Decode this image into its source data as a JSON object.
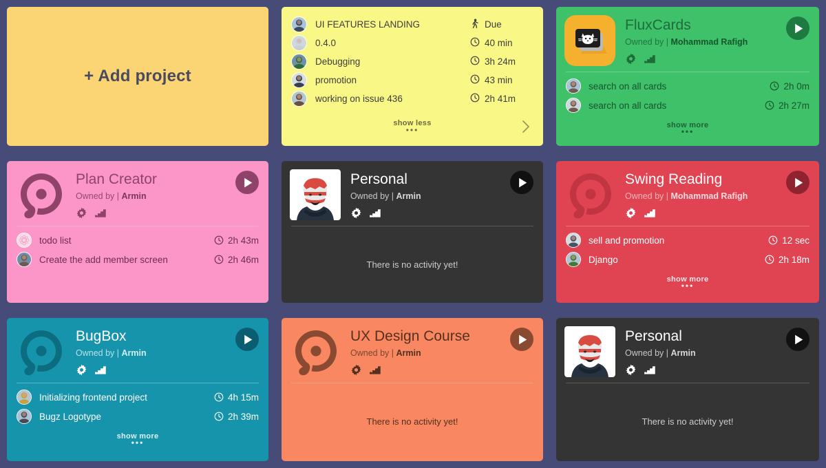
{
  "background_color": "#474b78",
  "add_project": {
    "label": "+ Add project",
    "bg": "#fbd474",
    "text_color": "#4a4a5e"
  },
  "tasks_card": {
    "bg": "#f9f786",
    "items": [
      {
        "title": "UI FEATURES LANDING",
        "meta": "Due",
        "icon": "walking-icon"
      },
      {
        "title": "0.4.0",
        "meta": "40 min",
        "icon": "clock-icon"
      },
      {
        "title": "Debugging",
        "meta": "3h 24m",
        "icon": "clock-icon"
      },
      {
        "title": "promotion",
        "meta": "43 min",
        "icon": "clock-icon"
      },
      {
        "title": "working on issue 436",
        "meta": "2h 41m",
        "icon": "clock-icon"
      }
    ],
    "show_less_label": "show less",
    "dots": "•••",
    "chevron": "chevron-right-icon"
  },
  "projects": [
    {
      "name": "FluxCards",
      "owned_by_label": "Owned by |",
      "owner": "Mohammad Rafigh",
      "bg": "#3fc16a",
      "title_color": "#1d6d3a",
      "owner_color": "#1f7440",
      "owner_name_color": "#14562c",
      "divider_color": "#6fd291",
      "play_bg": "#1d7a41",
      "play_fg": "#ffffff",
      "row_color": "#17532d",
      "logo": "fluxcards-icon",
      "logo_bg": "#f5b02e",
      "activities": [
        {
          "title": "search on all cards",
          "time": "2h 0m",
          "avatar": "#6d5b50"
        },
        {
          "title": "search on all cards",
          "time": "2h 27m",
          "avatar": "#6d5b50"
        }
      ],
      "footer": "show more",
      "footer_dots": "•••",
      "empty_text": null
    },
    {
      "name": "Plan Creator",
      "owned_by_label": "Owned by |",
      "owner": "Armin",
      "bg": "#fc96c8",
      "title_color": "#8f4369",
      "owner_color": "#94496e",
      "owner_name_color": "#7c365a",
      "divider_color": "#f2aed1",
      "play_bg": "#8f4369",
      "play_fg": "#ffffff",
      "row_color": "#6d2f50",
      "logo": "planty-logo-icon",
      "logo_bg": "#fc96c8",
      "logo_fg": "#8f4369",
      "activities": [
        {
          "title": "todo list",
          "time": "2h 43m",
          "avatar": "#fddbe9"
        },
        {
          "title": "Create the add member screen",
          "time": "2h 46m",
          "avatar": "#6d5b50"
        }
      ],
      "footer": null,
      "empty_text": null
    },
    {
      "name": "Personal",
      "owned_by_label": "Owned by |",
      "owner": "Armin",
      "bg": "#343434",
      "title_color": "#ffffff",
      "owner_color": "#c7c7c7",
      "owner_name_color": "#d8d8d8",
      "divider_color": "#595959",
      "play_bg": "#111111",
      "play_fg": "#ffffff",
      "row_color": "#cccccc",
      "logo": "photo-avatar-icon",
      "logo_bg": "#ffffff",
      "activities": [],
      "footer": null,
      "empty_text": "There is no activity yet!"
    },
    {
      "name": "Swing Reading",
      "owned_by_label": "Owned by |",
      "owner": "Mohammad Rafigh",
      "bg": "#e04453",
      "title_color": "#ffffff",
      "owner_color": "#f3b4b9",
      "owner_name_color": "#fbd9dc",
      "divider_color": "#ea767f",
      "play_bg": "#8f2430",
      "play_fg": "#ffffff",
      "row_color": "#ffffff",
      "logo": "planty-logo-icon",
      "logo_bg": "#e04453",
      "logo_fg": "#c03541",
      "activities": [
        {
          "title": "sell and promotion",
          "time": "12 sec",
          "avatar": "#4a5263"
        },
        {
          "title": "Django",
          "time": "2h 18m",
          "avatar": "#3e7a3a"
        }
      ],
      "footer": "show more",
      "footer_dots": "•••",
      "empty_text": null
    },
    {
      "name": "BugBox",
      "owned_by_label": "Owned by |",
      "owner": "Armin",
      "bg": "#1694ac",
      "title_color": "#ffffff",
      "owner_color": "#b6e1ea",
      "owner_name_color": "#d2eef4",
      "divider_color": "#5ab4c6",
      "play_bg": "#0b5e70",
      "play_fg": "#ffffff",
      "row_color": "#ffffff",
      "logo": "planty-logo-icon",
      "logo_bg": "#1694ac",
      "logo_fg": "#0d6d80",
      "activities": [
        {
          "title": "Initializing frontend project",
          "time": "4h 15m",
          "avatar": "#c7a33e"
        },
        {
          "title": "Bugz Logotype",
          "time": "2h 39m",
          "avatar": "#4a4a55"
        }
      ],
      "footer": "show more",
      "footer_dots": "•••",
      "empty_text": null
    },
    {
      "name": "UX Design Course",
      "owned_by_label": "Owned by |",
      "owner": "Armin",
      "bg": "#f98862",
      "title_color": "#56301f",
      "owner_color": "#7a4631",
      "owner_name_color": "#51301f",
      "divider_color": "#f0a488",
      "play_bg": "#8a4a31",
      "play_fg": "#ffffff",
      "row_color": "#51301f",
      "logo": "planty-logo-icon",
      "logo_bg": "#f98862",
      "logo_fg": "#8a4a31",
      "activities": [],
      "footer": null,
      "empty_text": "There is no activity yet!"
    },
    {
      "name": "Personal",
      "owned_by_label": "Owned by |",
      "owner": "Armin",
      "bg": "#343434",
      "title_color": "#ffffff",
      "owner_color": "#c7c7c7",
      "owner_name_color": "#d8d8d8",
      "divider_color": "#595959",
      "play_bg": "#111111",
      "play_fg": "#ffffff",
      "row_color": "#cccccc",
      "logo": "photo-avatar-icon",
      "logo_bg": "#ffffff",
      "activities": [],
      "footer": null,
      "empty_text": "There is no activity yet!"
    }
  ],
  "icons": {
    "gear": "gear-icon",
    "chart": "bar-chart-icon",
    "play": "play-icon",
    "clock": "clock-icon",
    "walking": "walking-icon"
  }
}
